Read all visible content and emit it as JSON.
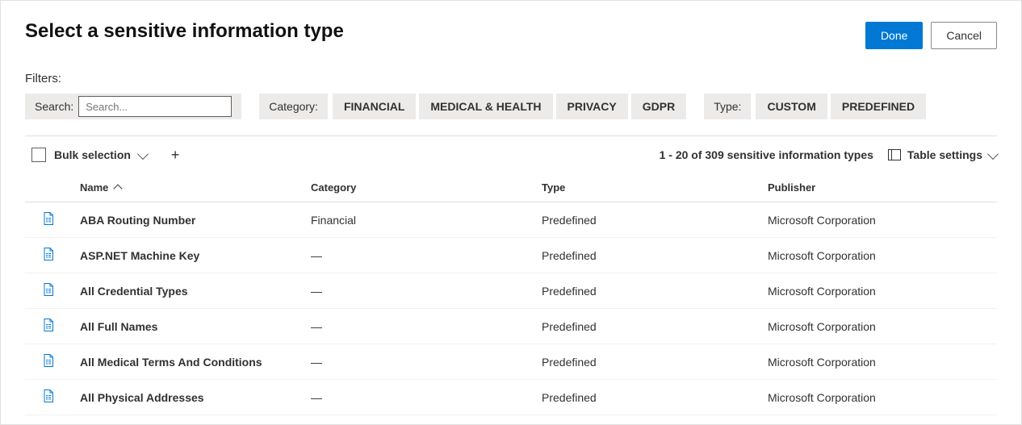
{
  "header": {
    "title": "Select a sensitive information type",
    "done_label": "Done",
    "cancel_label": "Cancel"
  },
  "filters": {
    "label": "Filters:",
    "search_label": "Search:",
    "search_placeholder": "Search...",
    "category_label": "Category:",
    "category_chips": [
      "FINANCIAL",
      "MEDICAL & HEALTH",
      "PRIVACY",
      "GDPR"
    ],
    "type_label": "Type:",
    "type_chips": [
      "CUSTOM",
      "PREDEFINED"
    ]
  },
  "toolbar": {
    "bulk_label": "Bulk selection",
    "count_text": "1 - 20 of 309 sensitive information types",
    "table_settings_label": "Table settings"
  },
  "table": {
    "columns": {
      "name": "Name",
      "category": "Category",
      "type": "Type",
      "publisher": "Publisher"
    },
    "rows": [
      {
        "name": "ABA Routing Number",
        "category": "Financial",
        "type": "Predefined",
        "publisher": "Microsoft Corporation"
      },
      {
        "name": "ASP.NET Machine Key",
        "category": "—",
        "type": "Predefined",
        "publisher": "Microsoft Corporation"
      },
      {
        "name": "All Credential Types",
        "category": "—",
        "type": "Predefined",
        "publisher": "Microsoft Corporation"
      },
      {
        "name": "All Full Names",
        "category": "—",
        "type": "Predefined",
        "publisher": "Microsoft Corporation"
      },
      {
        "name": "All Medical Terms And Conditions",
        "category": "—",
        "type": "Predefined",
        "publisher": "Microsoft Corporation"
      },
      {
        "name": "All Physical Addresses",
        "category": "—",
        "type": "Predefined",
        "publisher": "Microsoft Corporation"
      }
    ]
  }
}
